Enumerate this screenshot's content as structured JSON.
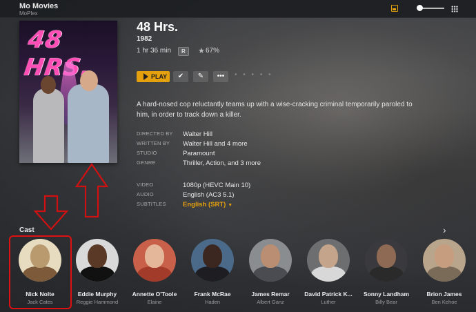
{
  "app": {
    "title": "Mo Movies",
    "subtitle": "MoPlex"
  },
  "movie": {
    "title": "48 Hrs.",
    "year": "1982",
    "duration": "1 hr 36 min",
    "content_rating": "R",
    "audience_score": "67%",
    "poster_title": "48 HRS.",
    "summary": "A hard-nosed cop reluctantly teams up with a wise-cracking criminal temporarily paroled to him, in order to track down a killer."
  },
  "actions": {
    "play_label": "PLAY",
    "watched_icon": "check-circle-icon",
    "edit_icon": "pencil-icon",
    "more_icon": "ellipsis-icon",
    "dots": "• • • • •"
  },
  "details": {
    "directed_by": {
      "label": "DIRECTED BY",
      "value": "Walter Hill"
    },
    "written_by": {
      "label": "WRITTEN BY",
      "value": "Walter Hill and 4 more"
    },
    "studio": {
      "label": "STUDIO",
      "value": "Paramount"
    },
    "genre": {
      "label": "GENRE",
      "value": "Thriller, Action, and 3 more"
    },
    "video": {
      "label": "VIDEO",
      "value": "1080p (HEVC Main 10)"
    },
    "audio": {
      "label": "AUDIO",
      "value": "English (AC3 5.1)"
    },
    "subtitles": {
      "label": "SUBTITLES",
      "value": "English (SRT)"
    }
  },
  "cast": {
    "heading": "Cast",
    "members": [
      {
        "name": "Nick Nolte",
        "role": "Jack Cates",
        "skin": "#b89a6e",
        "shirt": "#7c5a3a",
        "bg": "#e8dcc0"
      },
      {
        "name": "Eddie Murphy",
        "role": "Reggie Hammond",
        "skin": "#5a3a27",
        "shirt": "#111111",
        "bg": "#d9d9d9"
      },
      {
        "name": "Annette O'Toole",
        "role": "Elaine",
        "skin": "#e5b79a",
        "shirt": "#a33b2a",
        "bg": "#c9604a"
      },
      {
        "name": "Frank McRae",
        "role": "Haden",
        "skin": "#3b2720",
        "shirt": "#1e1e22",
        "bg": "#4b6a8a"
      },
      {
        "name": "James Remar",
        "role": "Albert Ganz",
        "skin": "#b98e72",
        "shirt": "#4a4c52",
        "bg": "#8a8d90"
      },
      {
        "name": "David Patrick K...",
        "role": "Luther",
        "skin": "#c4a48a",
        "shirt": "#d8d8d8",
        "bg": "#6d6e70"
      },
      {
        "name": "Sonny Landham",
        "role": "Billy Bear",
        "skin": "#8e6a55",
        "shirt": "#2a2a2a",
        "bg": "#3a3a3e"
      },
      {
        "name": "Brion James",
        "role": "Ben Kehoe",
        "skin": "#c79d7f",
        "shirt": "#7a6a58",
        "bg": "#b9a48c"
      }
    ]
  },
  "annotations": {
    "arrow_color": "#d11111"
  }
}
